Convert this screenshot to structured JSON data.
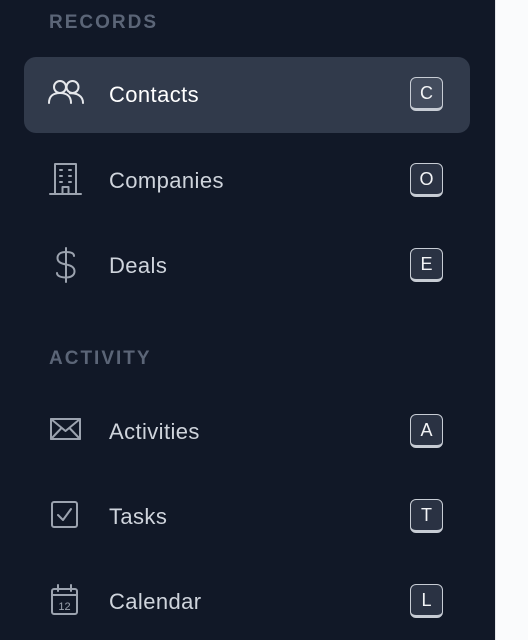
{
  "sidebar": {
    "sections": [
      {
        "heading": "RECORDS",
        "items": [
          {
            "label": "Contacts",
            "shortcut": "C",
            "icon": "users-icon",
            "active": true
          },
          {
            "label": "Companies",
            "shortcut": "O",
            "icon": "building-icon",
            "active": false
          },
          {
            "label": "Deals",
            "shortcut": "E",
            "icon": "dollar-icon",
            "active": false
          }
        ]
      },
      {
        "heading": "ACTIVITY",
        "items": [
          {
            "label": "Activities",
            "shortcut": "A",
            "icon": "envelope-icon",
            "active": false
          },
          {
            "label": "Tasks",
            "shortcut": "T",
            "icon": "checkbox-icon",
            "active": false
          },
          {
            "label": "Calendar",
            "shortcut": "L",
            "icon": "calendar-icon",
            "active": false,
            "icon_text": "12"
          }
        ]
      }
    ]
  },
  "colors": {
    "sidebar_bg": "#111827",
    "active_item_bg": "#313a4b",
    "heading": "#5b6577",
    "label": "#cfd4dc",
    "active_label": "#ffffff"
  }
}
